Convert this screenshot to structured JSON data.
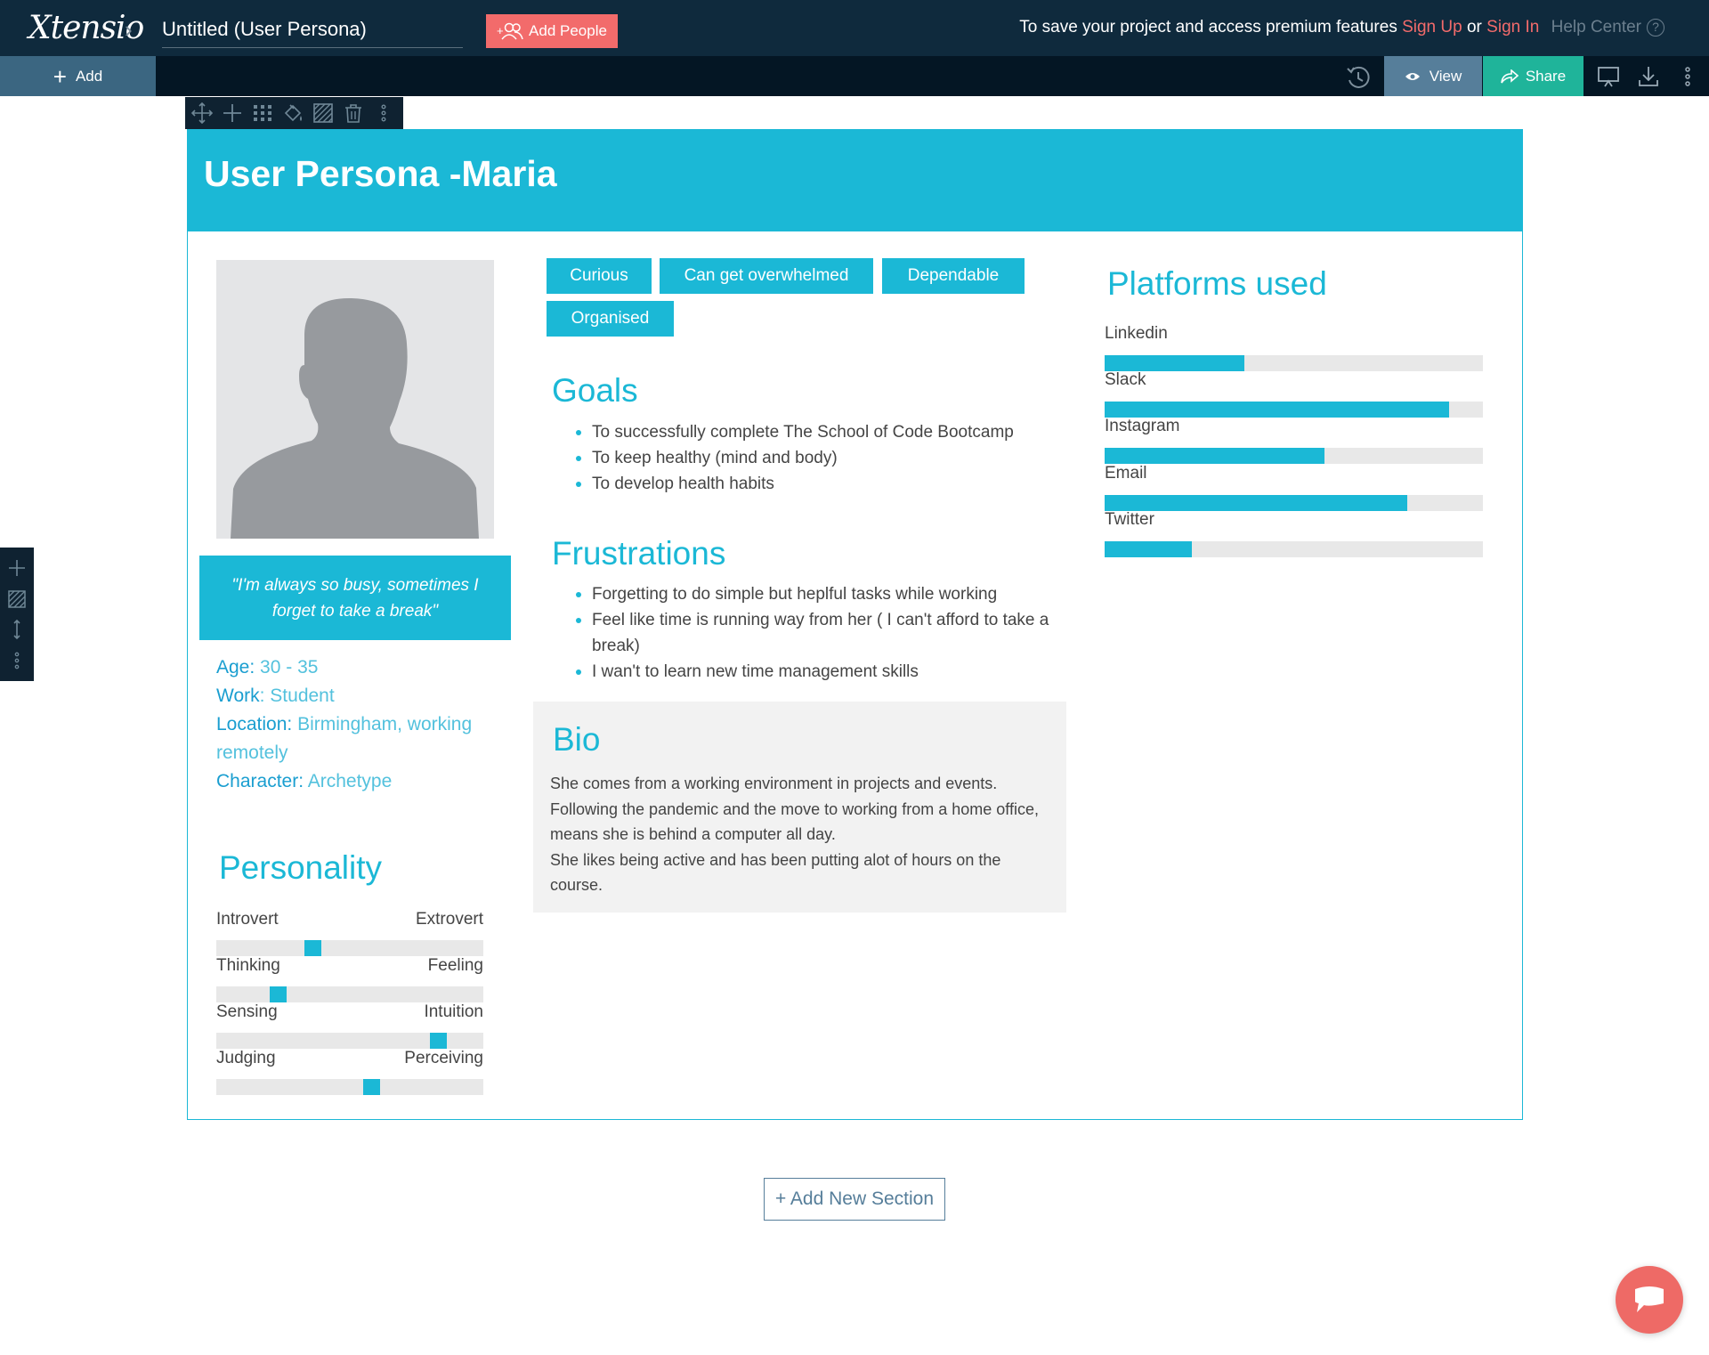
{
  "app": {
    "logo": "Xtensio",
    "doc_title": "Untitled (User Persona)"
  },
  "topbar": {
    "add_people": "Add People",
    "save_prefix": "To save your project and access premium features",
    "sign_up": "Sign Up",
    "or": "or",
    "sign_in": "Sign In",
    "help": "Help Center"
  },
  "subbar": {
    "add": "Add",
    "view": "View",
    "share": "Share"
  },
  "persona": {
    "title": "User Persona -Maria",
    "quote": "\"I'm always so busy, sometimes I forget to take a break\"",
    "info": [
      {
        "label": "Age:",
        "value": "30 - 35"
      },
      {
        "label": "Work",
        "value": ": Student"
      },
      {
        "label": "Location:",
        "value": "Birmingham, working remotely"
      },
      {
        "label": "Character:",
        "value": "Archetype"
      }
    ],
    "tags": [
      "Curious",
      "Can get overwhelmed",
      "Dependable",
      "Organised"
    ],
    "goals_title": "Goals",
    "goals": [
      "To successfully complete The School of Code Bootcamp",
      "To keep healthy (mind and body)",
      "To develop health habits"
    ],
    "frustrations_title": "Frustrations",
    "frustrations": [
      "Forgetting to do simple but heplful tasks while working",
      "Feel like time is running way from her ( I can't afford to take a break)",
      "I wan't to learn new time management skills"
    ],
    "bio_title": "Bio",
    "bio_p1": "She comes from a working environment in projects and events. Following the pandemic and the move to working from a home office, means she is behind a computer all day.",
    "bio_p2": "She likes being active and has been putting alot of hours on the course.",
    "personality_title": "Personality",
    "personality": [
      {
        "left": "Introvert",
        "right": "Extrovert",
        "level": 0.36
      },
      {
        "left": "Thinking",
        "right": "Feeling",
        "level": 0.23
      },
      {
        "left": "Sensing",
        "right": "Intuition",
        "level": 0.83
      },
      {
        "left": "Judging",
        "right": "Perceiving",
        "level": 0.58
      }
    ],
    "platforms_title": "Platforms used",
    "platforms": [
      {
        "name": "Linkedin",
        "level": 0.37
      },
      {
        "name": "Slack",
        "level": 0.91
      },
      {
        "name": "Instagram",
        "level": 0.58
      },
      {
        "name": "Email",
        "level": 0.8
      },
      {
        "name": "Twitter",
        "level": 0.23
      }
    ]
  },
  "add_section": "+ Add New Section",
  "colors": {
    "accent": "#1bb8d6",
    "navy": "#0f2a3d",
    "coral": "#f26b6b",
    "share": "#1fb49a"
  }
}
